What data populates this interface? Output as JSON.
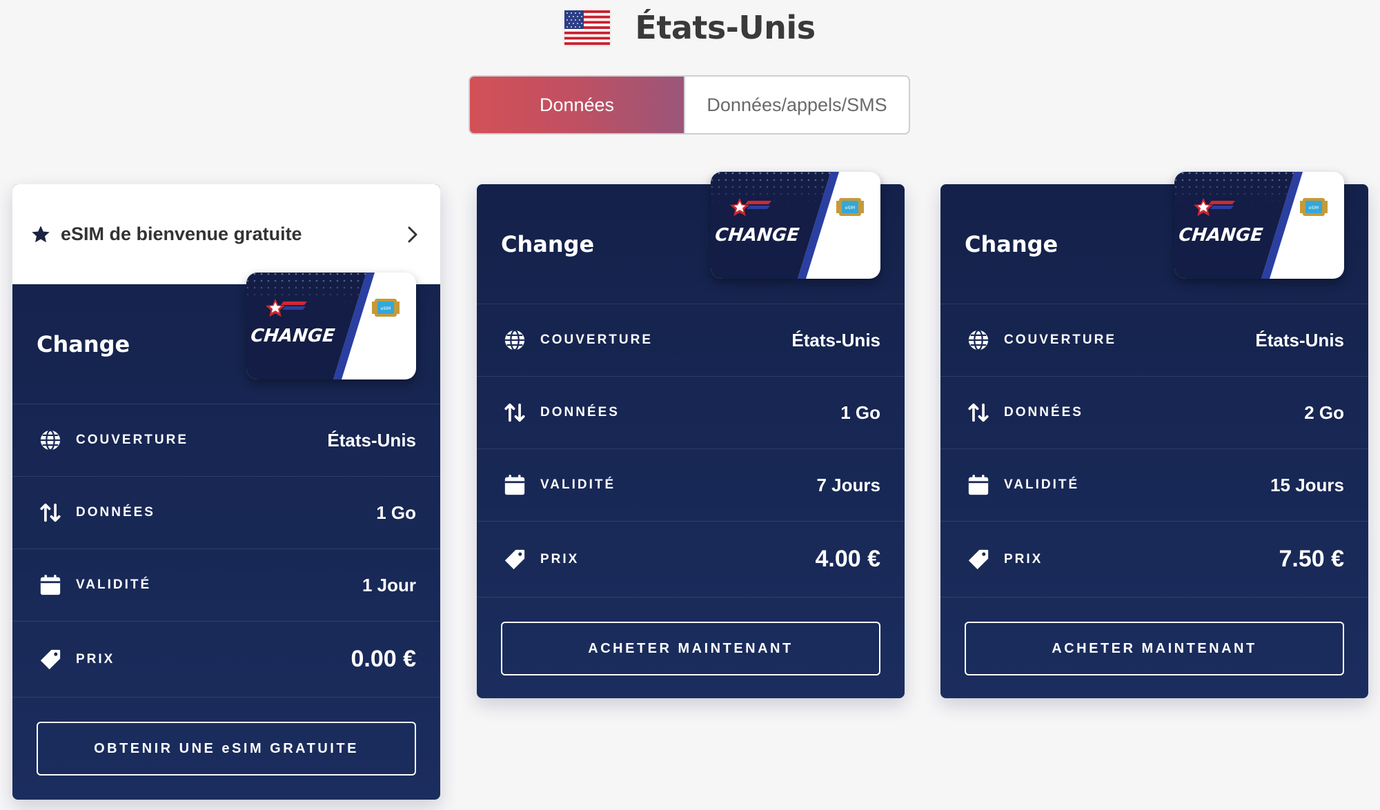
{
  "header": {
    "country": "États-Unis",
    "flag_icon": "us-flag-icon"
  },
  "tabs": [
    {
      "label": "Données",
      "active": true
    },
    {
      "label": "Données/appels/SMS",
      "active": false
    }
  ],
  "colors": {
    "card_top": "#14214a",
    "card_bottom": "#1b2d5e",
    "tab_active_start": "#d35157",
    "tab_active_end": "#9a567a"
  },
  "sim_card_brand": "CHANGE",
  "sim_chip_label": "eSIM",
  "labels": {
    "coverage": "COUVERTURE",
    "data": "DONNÉES",
    "validity": "VALIDITÉ",
    "price": "PRIX"
  },
  "plans": [
    {
      "welcome_banner": "eSIM de bienvenue gratuite",
      "name": "Change",
      "coverage": "États-Unis",
      "data": "1 Go",
      "validity": "1 Jour",
      "price": "0.00 €",
      "button": "OBTENIR UNE eSIM GRATUITE"
    },
    {
      "name": "Change",
      "coverage": "États-Unis",
      "data": "1 Go",
      "validity": "7 Jours",
      "price": "4.00 €",
      "button": "ACHETER MAINTENANT"
    },
    {
      "name": "Change",
      "coverage": "États-Unis",
      "data": "2 Go",
      "validity": "15 Jours",
      "price": "7.50 €",
      "button": "ACHETER MAINTENANT"
    }
  ]
}
